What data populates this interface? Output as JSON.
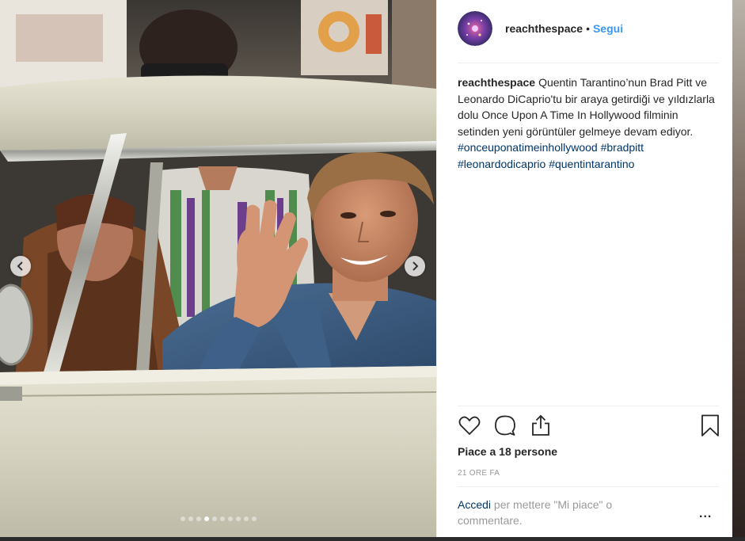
{
  "post": {
    "username": "reachthespace",
    "separator": "•",
    "follow_label": "Segui",
    "caption_user": "reachthespace",
    "caption_text": "Quentin Tarantino’nun Brad Pitt ve Leonardo DiCaprio'tu bir araya getirdiği ve yıldızlarla dolu Once Upon A Time In Hollywood filminin setinden yeni görüntüler gelmeye devam ediyor.",
    "hashtags": [
      "#onceuponatimeinhollywood",
      "#bradpitt",
      "#leonardodicaprio",
      "#quentintarantino"
    ],
    "likes_text": "Piace a 18 persone",
    "time_text": "21 ORE FA",
    "login_link": "Accedi",
    "login_suffix": "per mettere \"Mi piace\" o commentare.",
    "more_label": "..."
  },
  "carousel": {
    "total_slides": 10,
    "active_slide": 4
  },
  "icons": {
    "like": "heart-icon",
    "comment": "comment-bubble-icon",
    "share": "share-icon",
    "save": "bookmark-icon",
    "prev": "chevron-left-icon",
    "next": "chevron-right-icon"
  },
  "colors": {
    "link_blue": "#3897f0",
    "hashtag": "#003569",
    "text": "#262626",
    "muted": "#999999"
  }
}
